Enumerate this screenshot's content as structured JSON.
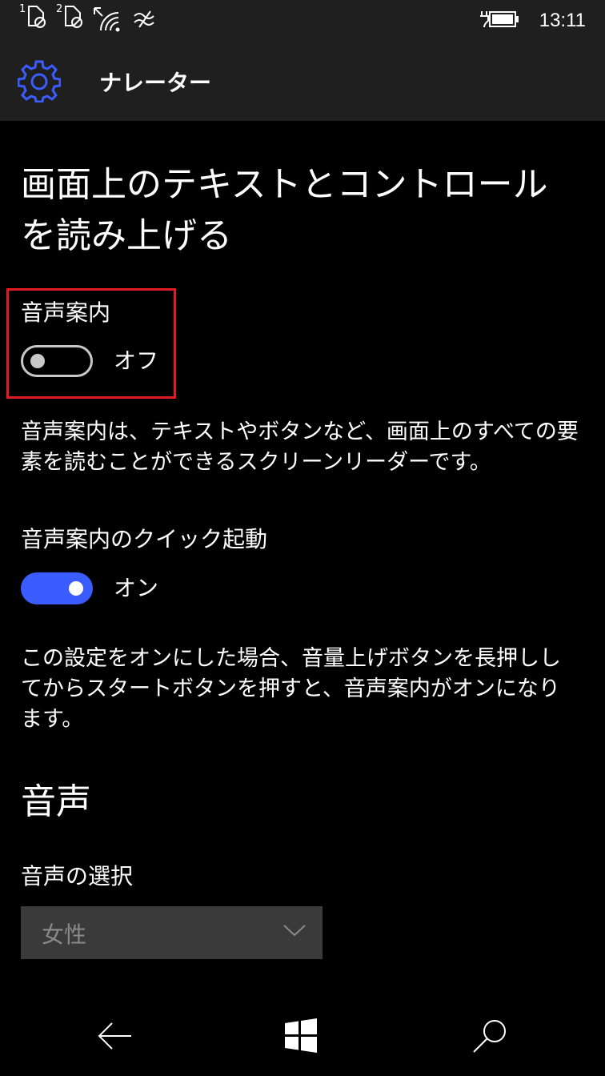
{
  "status_bar": {
    "sim1_label": "1",
    "sim2_label": "2",
    "time": "13:11",
    "icons": [
      "sim1-no-signal-icon",
      "sim2-no-signal-icon",
      "wifi-icon",
      "data-sense-icon",
      "battery-charging-icon"
    ]
  },
  "header": {
    "title": "ナレーター",
    "icon": "gear-icon"
  },
  "main": {
    "page_title": "画面上のテキストとコントロールを読み上げる",
    "narrator": {
      "label": "音声案内",
      "state_text": "オフ",
      "enabled": false,
      "description": "音声案内は、テキストやボタンなど、画面上のすべての要素を読むことができるスクリーンリーダーです。"
    },
    "quick_launch": {
      "label": "音声案内のクイック起動",
      "state_text": "オン",
      "enabled": true,
      "description": "この設定をオンにした場合、音量上げボタンを長押ししてからスタートボタンを押すと、音声案内がオンになります。"
    },
    "voice_section": {
      "title": "音声",
      "select_label": "音声の選択",
      "selected_value": "女性"
    }
  },
  "colors": {
    "accent": "#3b5cff",
    "highlight": "#e01b24",
    "header_bg": "#1f1f1f"
  },
  "navbar": {
    "icons": [
      "back-arrow-icon",
      "windows-start-icon",
      "search-icon"
    ]
  }
}
